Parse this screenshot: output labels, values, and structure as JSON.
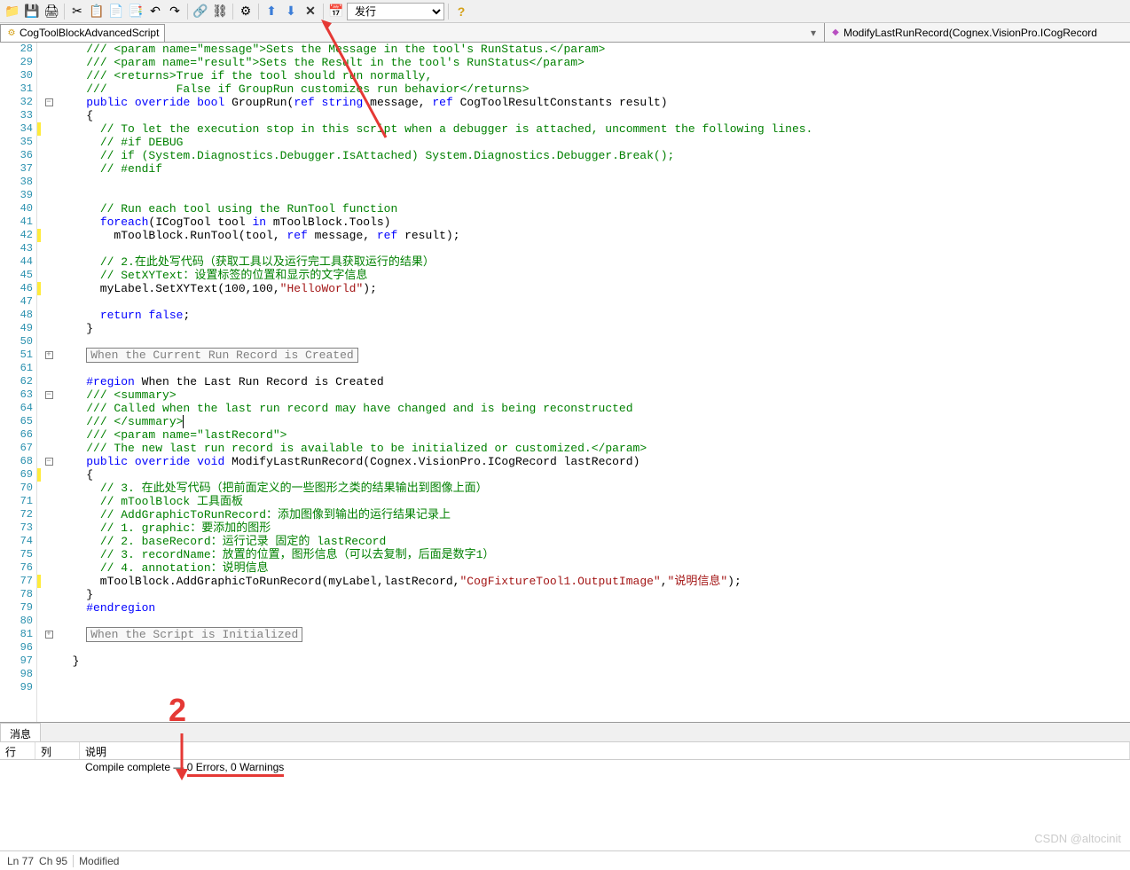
{
  "toolbar": {
    "combo_value": "发行",
    "icons": [
      "new-folder",
      "save",
      "print",
      "cut",
      "copy",
      "paste",
      "paste2",
      "undo",
      "redo",
      "link",
      "unlink",
      "gear",
      "up",
      "down",
      "cancel",
      "calendar"
    ]
  },
  "tabs": {
    "left_icon": "⚡",
    "left_label": "CogToolBlockAdvancedScript",
    "right_icon": "⚡",
    "right_label": "ModifyLastRunRecord(Cognex.VisionPro.ICogRecord "
  },
  "code": {
    "lines": [
      {
        "n": 28,
        "fold": "",
        "html": "    <span class='c-cm'>/// &lt;param name=\"message\"&gt;Sets the Message in the tool's RunStatus.&lt;/param&gt;</span>"
      },
      {
        "n": 29,
        "fold": "",
        "html": "    <span class='c-cm'>/// &lt;param name=\"result\"&gt;Sets the Result in the tool's RunStatus&lt;/param&gt;</span>"
      },
      {
        "n": 30,
        "fold": "",
        "html": "    <span class='c-cm'>/// &lt;returns&gt;True if the tool should run normally,</span>"
      },
      {
        "n": 31,
        "fold": "",
        "html": "    <span class='c-cm'>///          False if GroupRun customizes run behavior&lt;/returns&gt;</span>"
      },
      {
        "n": 32,
        "fold": "⊟",
        "html": "    <span class='c-kw'>public</span> <span class='c-kw'>override</span> <span class='c-kw'>bool</span> GroupRun(<span class='c-kw'>ref</span> <span class='c-kw'>string</span> message, <span class='c-kw'>ref</span> CogToolResultConstants result)"
      },
      {
        "n": 33,
        "fold": "",
        "html": "    {"
      },
      {
        "n": 34,
        "fold": "",
        "mark": true,
        "html": "      <span class='c-cm'>// To let the execution stop in this script when a debugger is attached, uncomment the following lines.</span>"
      },
      {
        "n": 35,
        "fold": "",
        "html": "      <span class='c-cm'>// #if DEBUG</span>"
      },
      {
        "n": 36,
        "fold": "",
        "html": "      <span class='c-cm'>// if (System.Diagnostics.Debugger.IsAttached) System.Diagnostics.Debugger.Break();</span>"
      },
      {
        "n": 37,
        "fold": "",
        "html": "      <span class='c-cm'>// #endif</span>"
      },
      {
        "n": 38,
        "fold": "",
        "html": ""
      },
      {
        "n": 39,
        "fold": "",
        "html": ""
      },
      {
        "n": 40,
        "fold": "",
        "html": "      <span class='c-cm'>// Run each tool using the RunTool function</span>"
      },
      {
        "n": 41,
        "fold": "",
        "html": "      <span class='c-kw'>foreach</span>(ICogTool tool <span class='c-kw'>in</span> mToolBlock.Tools)"
      },
      {
        "n": 42,
        "fold": "",
        "mark": true,
        "html": "        mToolBlock.RunTool(tool, <span class='c-kw'>ref</span> message, <span class='c-kw'>ref</span> result);"
      },
      {
        "n": 43,
        "fold": "",
        "html": ""
      },
      {
        "n": 44,
        "fold": "",
        "html": "      <span class='c-cm'>// 2.在此处写代码（获取工具以及运行完工具获取运行的结果）</span>"
      },
      {
        "n": 45,
        "fold": "",
        "html": "      <span class='c-cm'>// SetXYText：设置标签的位置和显示的文字信息</span>"
      },
      {
        "n": 46,
        "fold": "",
        "mark": true,
        "html": "      myLabel.SetXYText(100,100,<span class='c-str'>\"HelloWorld\"</span>);"
      },
      {
        "n": 47,
        "fold": "",
        "html": ""
      },
      {
        "n": 48,
        "fold": "",
        "html": "      <span class='c-kw'>return</span> <span class='c-kw'>false</span>;"
      },
      {
        "n": 49,
        "fold": "",
        "html": "    }"
      },
      {
        "n": 50,
        "fold": "",
        "html": ""
      },
      {
        "n": 51,
        "fold": "⊞",
        "html": "    <span class='collapsed-region'>When the Current Run Record is Created</span>"
      },
      {
        "n": 61,
        "fold": "",
        "html": ""
      },
      {
        "n": 62,
        "fold": "",
        "html": "    <span class='c-region'>#region</span> <span class='c-regiontxt'>When the Last Run Record is Created</span>"
      },
      {
        "n": 63,
        "fold": "⊟",
        "html": "    <span class='c-cm'>/// &lt;summary&gt;</span>"
      },
      {
        "n": 64,
        "fold": "",
        "html": "    <span class='c-cm'>/// Called when the last run record may have changed and is being reconstructed</span>"
      },
      {
        "n": 65,
        "fold": "",
        "html": "    <span class='c-cm'>/// &lt;/summary&gt;</span><span class='cursor-mark'></span>"
      },
      {
        "n": 66,
        "fold": "",
        "html": "    <span class='c-cm'>/// &lt;param name=\"lastRecord\"&gt;</span>"
      },
      {
        "n": 67,
        "fold": "",
        "html": "    <span class='c-cm'>/// The new last run record is available to be initialized or customized.&lt;/param&gt;</span>"
      },
      {
        "n": 68,
        "fold": "⊟",
        "html": "    <span class='c-kw'>public</span> <span class='c-kw'>override</span> <span class='c-kw'>void</span> ModifyLastRunRecord(Cognex.VisionPro.ICogRecord lastRecord)"
      },
      {
        "n": 69,
        "fold": "",
        "mark": true,
        "html": "    {"
      },
      {
        "n": 70,
        "fold": "",
        "html": "      <span class='c-cm'>// 3. 在此处写代码（把前面定义的一些图形之类的结果输出到图像上面）</span>"
      },
      {
        "n": 71,
        "fold": "",
        "html": "      <span class='c-cm'>// mToolBlock 工具面板</span>"
      },
      {
        "n": 72,
        "fold": "",
        "html": "      <span class='c-cm'>// AddGraphicToRunRecord：添加图像到输出的运行结果记录上</span>"
      },
      {
        "n": 73,
        "fold": "",
        "html": "      <span class='c-cm'>// 1. graphic：要添加的图形</span>"
      },
      {
        "n": 74,
        "fold": "",
        "html": "      <span class='c-cm'>// 2. baseRecord：运行记录 固定的 lastRecord</span>"
      },
      {
        "n": 75,
        "fold": "",
        "html": "      <span class='c-cm'>// 3. recordName：放置的位置，图形信息（可以去复制，后面是数字1）</span>"
      },
      {
        "n": 76,
        "fold": "",
        "html": "      <span class='c-cm'>// 4. annotation：说明信息</span>"
      },
      {
        "n": 77,
        "fold": "",
        "mark": true,
        "html": "      mToolBlock.AddGraphicToRunRecord(myLabel,lastRecord,<span class='c-str'>\"CogFixtureTool1.OutputImage\"</span>,<span class='c-str'>\"说明信息\"</span>);"
      },
      {
        "n": 78,
        "fold": "",
        "html": "    }"
      },
      {
        "n": 79,
        "fold": "",
        "html": "    <span class='c-region'>#endregion</span>"
      },
      {
        "n": 80,
        "fold": "",
        "html": ""
      },
      {
        "n": 81,
        "fold": "⊞",
        "html": "    <span class='collapsed-region'>When the Script is Initialized</span>"
      },
      {
        "n": 96,
        "fold": "",
        "html": ""
      },
      {
        "n": 97,
        "fold": "",
        "html": "  }"
      },
      {
        "n": 98,
        "fold": "",
        "html": ""
      },
      {
        "n": 99,
        "fold": "",
        "html": ""
      }
    ]
  },
  "messages": {
    "tab": "消息",
    "col_row": "行",
    "col_col": "列",
    "col_desc": "说明",
    "compile_text_prefix": "Compile complete — ",
    "compile_text_errors": "0 Errors, 0 Warnings"
  },
  "status": {
    "ln": "Ln 77",
    "ch": "Ch 95",
    "modified": "Modified"
  },
  "watermark": "CSDN @altocinit",
  "annotation_number": "2"
}
